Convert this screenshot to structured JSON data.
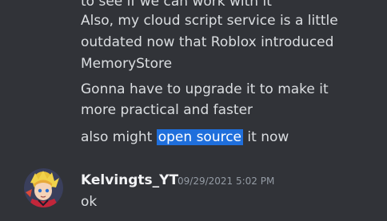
{
  "messages": {
    "cutoff_line": "to see if we can work with it",
    "line1": "Also, my cloud script service is a little",
    "line2": "outdated now that Roblox introduced",
    "line3": "MemoryStore",
    "line4": "Gonna have to upgrade it to make it",
    "line5": "more practical and faster",
    "line6_before": "also might ",
    "line6_highlight": "open source",
    "line6_after": " it now"
  },
  "next_message": {
    "author": "Kelvingts_YT",
    "timestamp": "09/29/2021 5:02 PM",
    "content": "ok"
  },
  "colors": {
    "background": "#313338",
    "text": "#dbdee1",
    "author": "#f2f3f5",
    "timestamp": "#949ba4",
    "highlight": "#1f6fdc"
  },
  "icons": {
    "avatar": "anime-avatar-icon"
  }
}
